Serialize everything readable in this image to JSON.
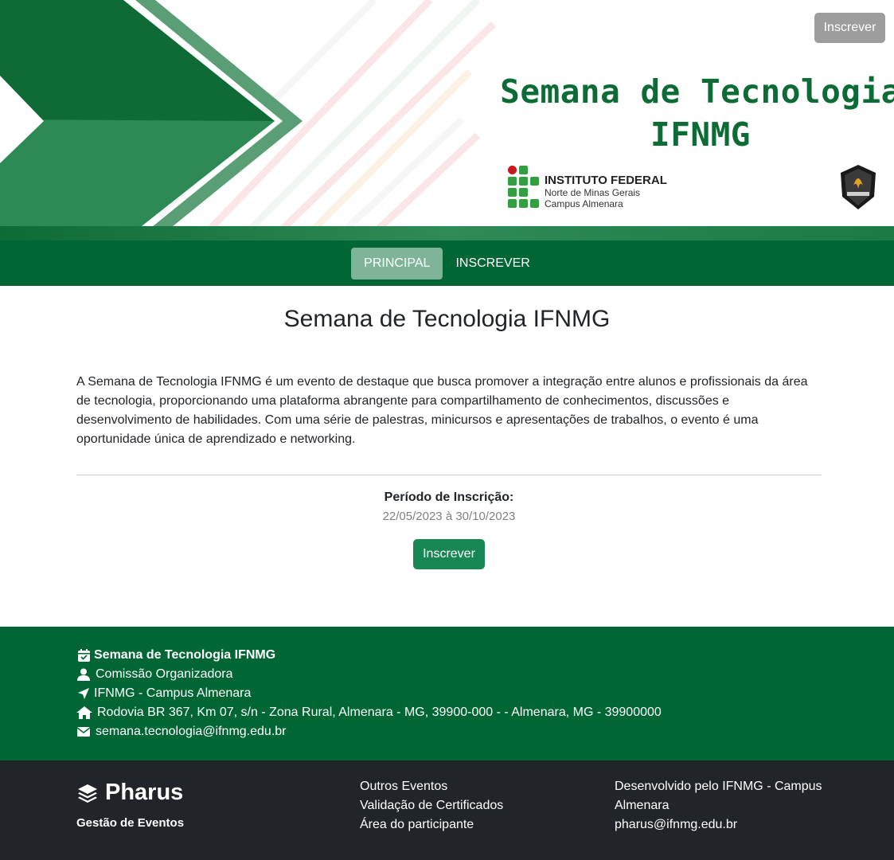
{
  "banner": {
    "title_line1": "Semana de Tecnologia",
    "title_line2": "IFNMG",
    "institute_name": "INSTITUTO FEDERAL",
    "institute_region": "Norte de Minas Gerais",
    "institute_campus": "Campus Almenara",
    "badge_icon": "informatica-shield-icon",
    "subscribe_button": "Inscrever"
  },
  "nav": {
    "items": [
      {
        "label": "PRINCIPAL",
        "active": true
      },
      {
        "label": "INSCREVER",
        "active": false
      }
    ]
  },
  "main": {
    "title": "Semana de Tecnologia IFNMG",
    "description": "A Semana de Tecnologia IFNMG é um evento de destaque que busca promover a integração entre alunos e profissionais da área de tecnologia, proporcionando uma plataforma abrangente para compartilhamento de conhecimentos, discussões e desenvolvimento de habilidades. Com uma série de palestras, minicursos e apresentações de trabalhos, o evento é uma oportunidade única de aprendizado e networking.",
    "period_label": "Período de Inscrição:",
    "period_dates": "22/05/2023 à 30/10/2023",
    "subscribe_button": "Inscrever"
  },
  "event_info": {
    "event_name": "Semana de Tecnologia IFNMG",
    "organizer": "Comissão Organizadora",
    "venue": "IFNMG - Campus Almenara",
    "address": "Rodovia BR 367, Km 07, s/n - Zona Rural, Almenara - MG, 39900-000 - - Almenara, MG - 39900000",
    "email": "semana.tecnologia@ifnmg.edu.br"
  },
  "footer": {
    "brand_name": "Pharus",
    "brand_tagline": "Gestão de Eventos",
    "links": [
      "Outros Eventos",
      "Validação de Certificados",
      "Área do participante"
    ],
    "developed_by": "Desenvolvido pelo IFNMG - Campus Almenara",
    "contact_email": "pharus@ifnmg.edu.br"
  },
  "colors": {
    "primary_green": "#006633",
    "button_green": "#198754",
    "dark_footer": "#212529",
    "title_green": "#0d6b35"
  }
}
